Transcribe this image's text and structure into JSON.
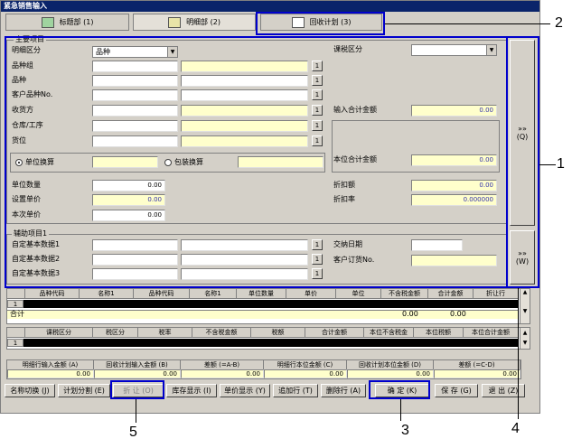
{
  "window_title": "紧急销售输入",
  "tabs": [
    {
      "label": "标题部 (1)"
    },
    {
      "label": "明细部 (2)"
    },
    {
      "label": "回收计划 (3)"
    }
  ],
  "main_group": {
    "title": "主要项目",
    "labels": {
      "detail_type": "明细区分",
      "product_group": "品种组",
      "product": "品种",
      "customer_product_no": "客户品种No.",
      "consignee": "收货方",
      "warehouse": "仓库/工序",
      "location": "货位",
      "unit_convert": "单位换算",
      "pack_convert": "包装换算",
      "unit_qty": "单位数量",
      "set_price": "设置单价",
      "current_price": "本次单价",
      "tax_type": "课税区分",
      "input_total": "输入合计金额",
      "local_total": "本位合计金额",
      "discount_amt": "折扣额",
      "discount_rate": "折扣率"
    },
    "values": {
      "detail_type": "品种",
      "unit_qty": "0.00",
      "set_price": "0.00",
      "current_price": "0.00",
      "input_total": "0.00",
      "local_total": "0.00",
      "discount_amt": "0.00",
      "discount_rate": "0.000000"
    }
  },
  "aux_group": {
    "title": "辅助项目1",
    "labels": {
      "custom1": "自定基本数据1",
      "custom2": "自定基本数据2",
      "custom3": "自定基本数据3",
      "delivery_date": "交纳日期",
      "customer_order_no": "客户订货No."
    }
  },
  "side_buttons": [
    {
      "arrows": "»»",
      "key": "(Q)"
    },
    {
      "arrows": "»»",
      "key": "(W)"
    }
  ],
  "small_button_label": "1",
  "grid1": {
    "headers": [
      "品种代码",
      "名称1",
      "品种代码",
      "名称1",
      "单位数量",
      "单价",
      "单位",
      "不含税金额",
      "合计金额",
      "折让行"
    ],
    "row_num": "1",
    "total_label": "合计",
    "total_values": [
      "0.00",
      "0.00"
    ]
  },
  "grid2": {
    "headers": [
      "课税区分",
      "税区分",
      "税率",
      "不含税金额",
      "税额",
      "合计金额",
      "本位不含税金",
      "本位税额",
      "本位合计金额"
    ],
    "row_num": "1"
  },
  "summary": {
    "headers": [
      "明细行输入金额 (A)",
      "回收计划输入金额 (B)",
      "差额 (=A-B)",
      "明细行本位金额 (C)",
      "回收计划本位金额 (D)",
      "差额 (=C-D)"
    ],
    "values": [
      "0.00",
      "0.00",
      "0.00",
      "0.00",
      "0.00",
      "0.00"
    ]
  },
  "bottom_buttons": [
    {
      "label": "名称切换 (J)",
      "disabled": false
    },
    {
      "label": "计划分割 (E)",
      "disabled": false
    },
    {
      "label": "折 让 (O)",
      "disabled": true
    },
    {
      "label": "库存显示 (I)",
      "disabled": false
    },
    {
      "label": "单价显示 (Y)",
      "disabled": false
    },
    {
      "label": "追加行 (T)",
      "disabled": false
    },
    {
      "label": "删除行 (A)",
      "disabled": false
    },
    {
      "label": "确 定 (K)",
      "disabled": false
    },
    {
      "label": "保 存 (G)",
      "disabled": false
    },
    {
      "label": "退 出 (Z)",
      "disabled": false
    }
  ],
  "callouts": [
    "1",
    "2",
    "3",
    "4",
    "5"
  ],
  "colors": {
    "annotation": "#0000cc",
    "title_bar": "#0a246a",
    "highlight_field": "#ffffcc"
  }
}
